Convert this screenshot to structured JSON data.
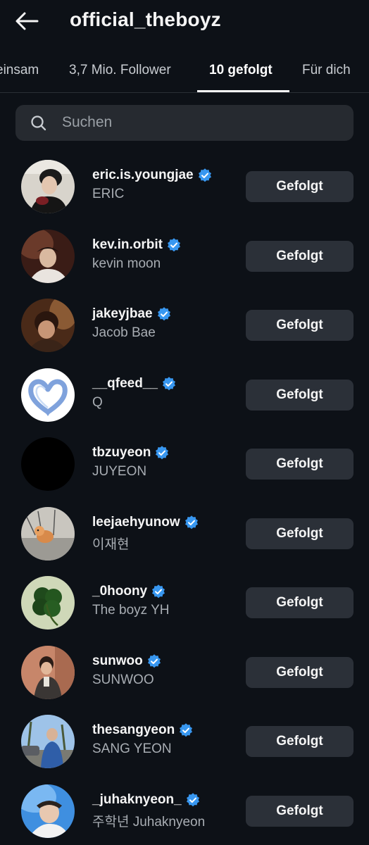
{
  "header": {
    "title": "official_theboyz",
    "back_icon": "arrow-left-icon"
  },
  "tabs": [
    {
      "label": "einsam",
      "active": false
    },
    {
      "label": "3,7 Mio. Follower",
      "active": false
    },
    {
      "label": "10 gefolgt",
      "active": true
    },
    {
      "label": "Für dich",
      "active": false
    }
  ],
  "search": {
    "placeholder": "Suchen",
    "value": "",
    "icon": "search-icon"
  },
  "accounts": [
    {
      "username": "eric.is.youngjae",
      "name": "ERIC",
      "verified": true,
      "button": "Gefolgt"
    },
    {
      "username": "kev.in.orbit",
      "name": "kevin moon",
      "verified": true,
      "button": "Gefolgt"
    },
    {
      "username": "jakeyjbae",
      "name": "Jacob Bae",
      "verified": true,
      "button": "Gefolgt"
    },
    {
      "username": "__qfeed__",
      "name": "Q",
      "verified": true,
      "button": "Gefolgt"
    },
    {
      "username": "tbzuyeon",
      "name": "JUYEON",
      "verified": true,
      "button": "Gefolgt"
    },
    {
      "username": "leejaehyunow",
      "name": "이재현",
      "verified": true,
      "button": "Gefolgt"
    },
    {
      "username": "_0hoony",
      "name": "The boyz YH",
      "verified": true,
      "button": "Gefolgt"
    },
    {
      "username": "sunwoo",
      "name": "SUNWOO",
      "verified": true,
      "button": "Gefolgt"
    },
    {
      "username": "thesangyeon",
      "name": "SANG YEON",
      "verified": true,
      "button": "Gefolgt"
    },
    {
      "username": "_juhaknyeon_",
      "name": "주학년 Juhaknyeon",
      "verified": true,
      "button": "Gefolgt"
    }
  ],
  "colors": {
    "background": "#0d1117",
    "verified_badge": "#3897f0",
    "button_bg": "#2b3038"
  }
}
